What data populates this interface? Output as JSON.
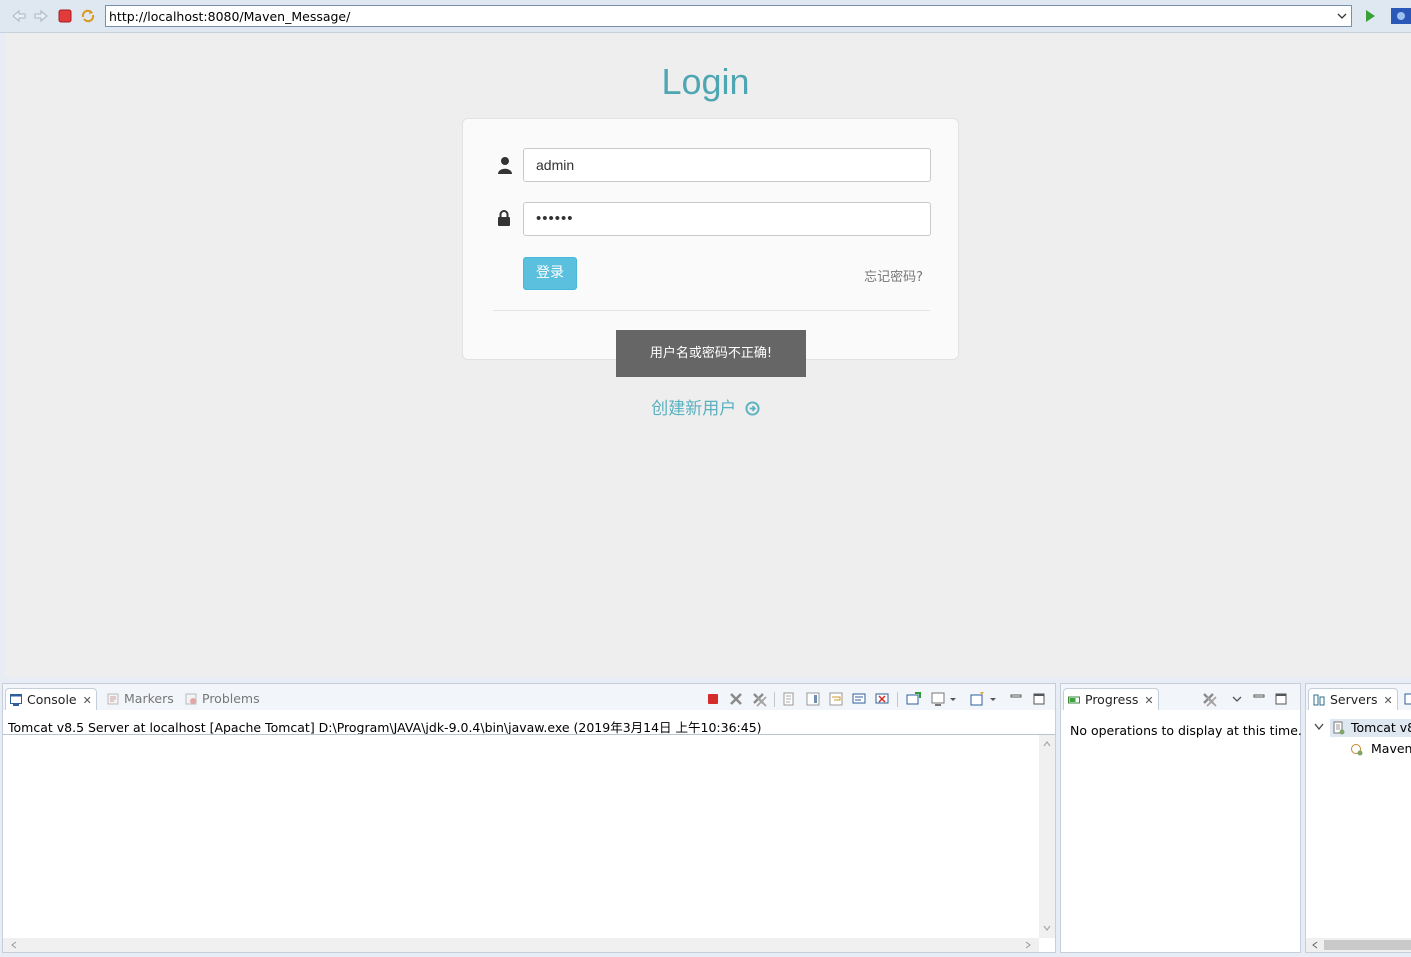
{
  "browser": {
    "url": "http://localhost:8080/Maven_Message/",
    "back_icon": "back-arrow-icon",
    "forward_icon": "forward-arrow-icon",
    "stop_icon": "stop-icon",
    "refresh_icon": "refresh-icon",
    "go_icon": "go-icon"
  },
  "login": {
    "title": "Login",
    "username_value": "admin",
    "password_value": "••••••",
    "submit_label": "登录",
    "forgot_label": "忘记密码?",
    "error_toast": "用户名或密码不正确!",
    "create_user_label": "创建新用户",
    "accent_color": "#4fa6b3",
    "button_color": "#5bc0de"
  },
  "console_view": {
    "tabs": [
      {
        "label": "Console",
        "active": true
      },
      {
        "label": "Markers",
        "active": false
      },
      {
        "label": "Problems",
        "active": false
      }
    ],
    "launch_line": "Tomcat v8.5 Server at localhost [Apache Tomcat] D:\\Program\\JAVA\\jdk-9.0.4\\bin\\javaw.exe (2019年3月14日 上午10:36:45)"
  },
  "progress_view": {
    "tab_label": "Progress",
    "message": "No operations to display at this time."
  },
  "servers_view": {
    "tab_label": "Servers",
    "server_label": "Tomcat v8",
    "module_label": "Maven_"
  }
}
